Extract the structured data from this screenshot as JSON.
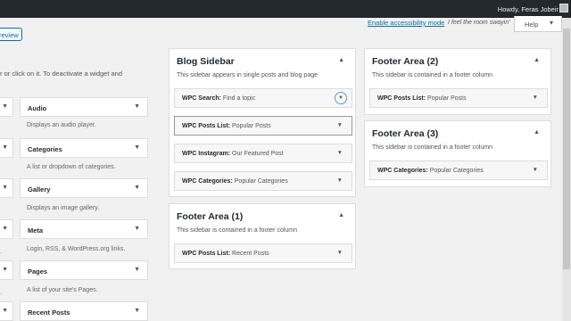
{
  "adminbar": {
    "howdy": "Howdy, Feras Jobeir"
  },
  "screen_meta": {
    "accessibility_link": "Enable accessibility mode",
    "quote": "I feel the room swayin'",
    "help": "Help",
    "help_icon": "chevron-down-icon"
  },
  "left": {
    "preview_button": "review",
    "intro": "r or click on it. To deactivate a widget and",
    "widgets": [
      {
        "name": "Audio",
        "desc": "Displays an audio player."
      },
      {
        "name": "Categories",
        "desc": "A list or dropdown of categories."
      },
      {
        "name": "Gallery",
        "desc": "Displays an image gallery."
      },
      {
        "name": "Meta",
        "desc": "Login, RSS, & WordPress.org links."
      },
      {
        "name": "Pages",
        "desc": "A list of your site's Pages."
      },
      {
        "name": "Recent Posts",
        "desc": ""
      }
    ],
    "left_dots": [
      ".",
      ".",
      "."
    ]
  },
  "blog_sidebar": {
    "title": "Blog Sidebar",
    "desc": "This sidebar appears in single posts and blog page",
    "widgets": [
      {
        "name": "WPC Search",
        "title": "Find a topic"
      },
      {
        "name": "WPC Posts List",
        "title": "Popular Posts"
      },
      {
        "name": "WPC Instagram",
        "title": "Our Featured Post"
      },
      {
        "name": "WPC Categories",
        "title": "Popular Categories"
      }
    ]
  },
  "footer1": {
    "title": "Footer Area (1)",
    "desc": "This sidebar is contained in a footer column",
    "widgets": [
      {
        "name": "WPC Posts List",
        "title": "Recent Posts"
      }
    ]
  },
  "footer2": {
    "title": "Footer Area (2)",
    "desc": "This sidebar is contained in a footer column",
    "widgets": [
      {
        "name": "WPC Posts List",
        "title": "Popular Posts"
      }
    ]
  },
  "footer3": {
    "title": "Footer Area (3)",
    "desc": "This sidebar is contained in a footer column",
    "widgets": [
      {
        "name": "WPC Categories",
        "title": "Popular Categories"
      }
    ]
  },
  "separator": ":",
  "colors": {
    "adminbar": "#23282d",
    "link": "#0073aa",
    "focus": "#5b9dd9"
  }
}
